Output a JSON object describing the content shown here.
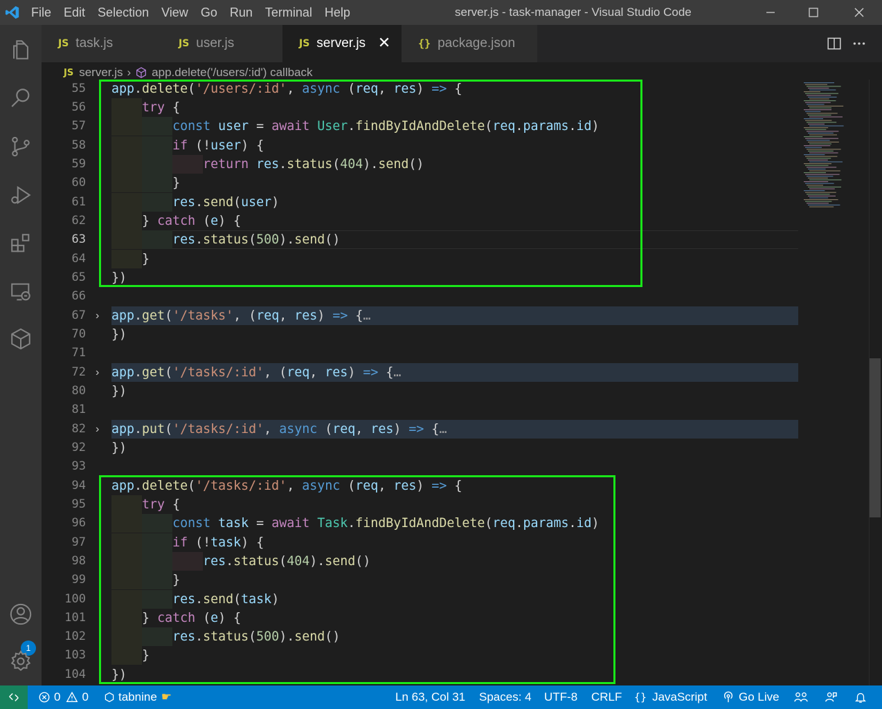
{
  "app": {
    "window_title": "server.js - task-manager - Visual Studio Code",
    "menu": [
      "File",
      "Edit",
      "Selection",
      "View",
      "Go",
      "Run",
      "Terminal",
      "Help"
    ]
  },
  "activity_bar": {
    "items": [
      "explorer-icon",
      "search-icon",
      "source-control-icon",
      "run-debug-icon",
      "extensions-icon",
      "remote-explorer-icon",
      "tabnine-icon"
    ],
    "bottom": [
      "accounts-icon",
      "manage-gear-icon"
    ],
    "accounts_badge": "1"
  },
  "tabs": [
    {
      "icon": "JS",
      "label": "task.js",
      "active": false
    },
    {
      "icon": "JS",
      "label": "user.js",
      "active": false
    },
    {
      "icon": "JS",
      "label": "server.js",
      "active": true
    },
    {
      "icon": "{}",
      "label": "package.json",
      "active": false
    }
  ],
  "breadcrumb": {
    "file_icon": "JS",
    "file": "server.js",
    "symbol": "app.delete('/users/:id') callback"
  },
  "editor": {
    "lines": [
      {
        "n": "55",
        "code": "app.delete('/users/:id', async (req, res) => {"
      },
      {
        "n": "56",
        "code": "    try {"
      },
      {
        "n": "57",
        "code": "        const user = await User.findByIdAndDelete(req.params.id)"
      },
      {
        "n": "58",
        "code": "        if (!user) {"
      },
      {
        "n": "59",
        "code": "            return res.status(404).send()"
      },
      {
        "n": "60",
        "code": "        }"
      },
      {
        "n": "61",
        "code": "        res.send(user)"
      },
      {
        "n": "62",
        "code": "    } catch (e) {"
      },
      {
        "n": "63",
        "code": "        res.status(500).send()"
      },
      {
        "n": "64",
        "code": "    }"
      },
      {
        "n": "65",
        "code": "})"
      },
      {
        "n": "66",
        "code": ""
      },
      {
        "n": "67",
        "code": "app.get('/tasks', (req, res) => {…",
        "folded": true
      },
      {
        "n": "70",
        "code": "})"
      },
      {
        "n": "71",
        "code": ""
      },
      {
        "n": "72",
        "code": "app.get('/tasks/:id', (req, res) => {…",
        "folded": true
      },
      {
        "n": "80",
        "code": "})"
      },
      {
        "n": "81",
        "code": ""
      },
      {
        "n": "82",
        "code": "app.put('/tasks/:id', async (req, res) => {…",
        "folded": true
      },
      {
        "n": "92",
        "code": "})"
      },
      {
        "n": "93",
        "code": ""
      },
      {
        "n": "94",
        "code": "app.delete('/tasks/:id', async (req, res) => {"
      },
      {
        "n": "95",
        "code": "    try {"
      },
      {
        "n": "96",
        "code": "        const task = await Task.findByIdAndDelete(req.params.id)"
      },
      {
        "n": "97",
        "code": "        if (!task) {"
      },
      {
        "n": "98",
        "code": "            res.status(404).send()"
      },
      {
        "n": "99",
        "code": "        }"
      },
      {
        "n": "100",
        "code": "        res.send(task)"
      },
      {
        "n": "101",
        "code": "    } catch (e) {"
      },
      {
        "n": "102",
        "code": "        res.status(500).send()"
      },
      {
        "n": "103",
        "code": "    }"
      },
      {
        "n": "104",
        "code": "})"
      }
    ],
    "current_line": "63"
  },
  "status_bar": {
    "errors": "0",
    "warnings": "0",
    "tabnine": "tabnine",
    "cursor": "Ln 63, Col 31",
    "spaces": "Spaces: 4",
    "encoding": "UTF-8",
    "eol": "CRLF",
    "language": "JavaScript",
    "go_live": "Go Live"
  },
  "colors": {
    "highlight_box": "#19e619",
    "status_bar": "#007acc",
    "remote_button": "#16825d"
  }
}
